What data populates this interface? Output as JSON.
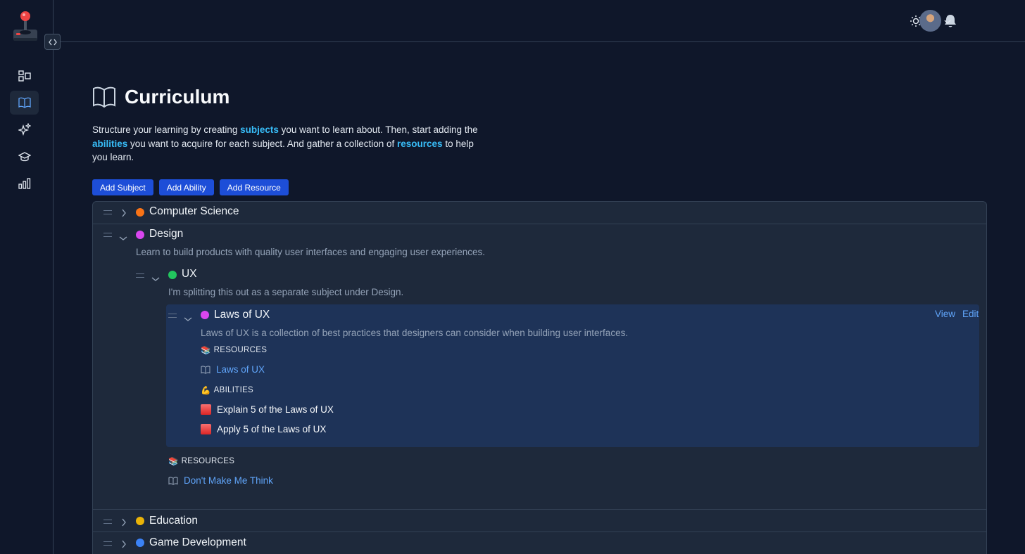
{
  "header": {
    "sun_icon": "sun-icon",
    "bell_icon": "bell-icon",
    "avatar_icon": "user-avatar"
  },
  "sidebar": {
    "items": [
      {
        "icon": "dashboard-icon"
      },
      {
        "icon": "book-icon",
        "active": true
      },
      {
        "icon": "sparkles-icon"
      },
      {
        "icon": "graduation-cap-icon"
      },
      {
        "icon": "bar-chart-icon"
      }
    ]
  },
  "page": {
    "title": "Curriculum",
    "intro": {
      "part1": "Structure your learning by creating ",
      "subjects": "subjects",
      "part2": " you want to learn about. Then, start adding the ",
      "abilities": "abilities",
      "part3": " you want to acquire for each subject. And gather a collection of ",
      "resources": "resources",
      "part4": " to help you learn."
    },
    "buttons": {
      "add_subject": "Add Subject",
      "add_ability": "Add Ability",
      "add_resource": "Add Resource"
    }
  },
  "tree": {
    "subjects": [
      {
        "name": "Computer Science",
        "color": "#f97316",
        "expanded": false
      },
      {
        "name": "Design",
        "color": "#d946ef",
        "expanded": true,
        "description": "Learn to build products with quality user interfaces and engaging user experiences.",
        "children": [
          {
            "name": "UX",
            "color": "#22c55e",
            "expanded": true,
            "description": "I'm splitting this out as a separate subject under Design.",
            "children": [
              {
                "name": "Laws of UX",
                "color": "#d946ef",
                "expanded": true,
                "description": "Laws of UX is a collection of best practices that designers can consider when building user interfaces.",
                "actions": {
                  "view": "View",
                  "edit": "Edit"
                },
                "resources_heading": "RESOURCES",
                "resources": [
                  "Laws of UX"
                ],
                "abilities_heading": "ABILITIES",
                "abilities": [
                  "Explain 5 of the Laws of UX",
                  "Apply 5 of the Laws of UX"
                ]
              }
            ],
            "resources_heading": "RESOURCES",
            "resources": [
              "Don't Make Me Think"
            ]
          }
        ]
      },
      {
        "name": "Education",
        "color": "#eab308",
        "expanded": false
      },
      {
        "name": "Game Development",
        "color": "#3b82f6",
        "expanded": false
      }
    ]
  },
  "colors": {
    "background": "#0f172a",
    "panel": "#1e293b",
    "accent": "#1d4ed8",
    "link": "#60a5fa",
    "highlight": "#38bdf8"
  }
}
